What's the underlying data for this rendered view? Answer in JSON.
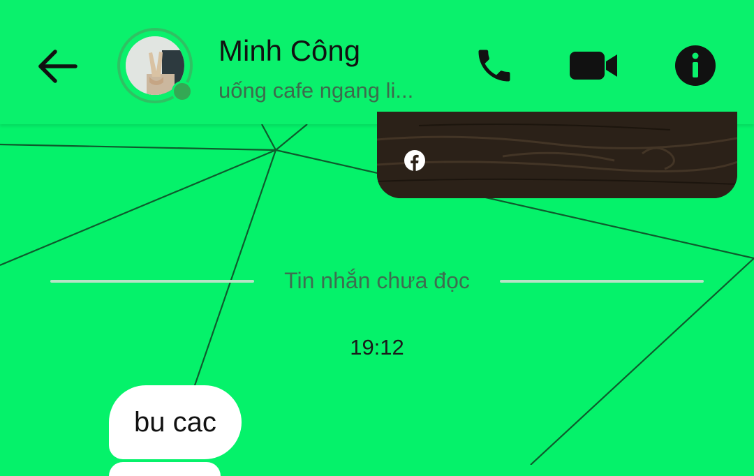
{
  "header": {
    "contact_name": "Minh Công",
    "status_text": "uống cafe ngang li...",
    "icons": {
      "back": "arrow-left-icon",
      "call": "phone-icon",
      "video": "video-camera-icon",
      "info": "info-icon",
      "online": "online-status-dot"
    }
  },
  "conversation": {
    "media": {
      "source_icon": "facebook-icon"
    },
    "unread_divider": "Tin nhắn chưa đọc",
    "timestamp": "19:12",
    "messages": [
      {
        "text": "bu cac",
        "direction": "incoming"
      }
    ]
  },
  "colors": {
    "background": "#05f26a",
    "header": "#0af16c",
    "online": "#34a854",
    "bubble": "#ffffff"
  }
}
